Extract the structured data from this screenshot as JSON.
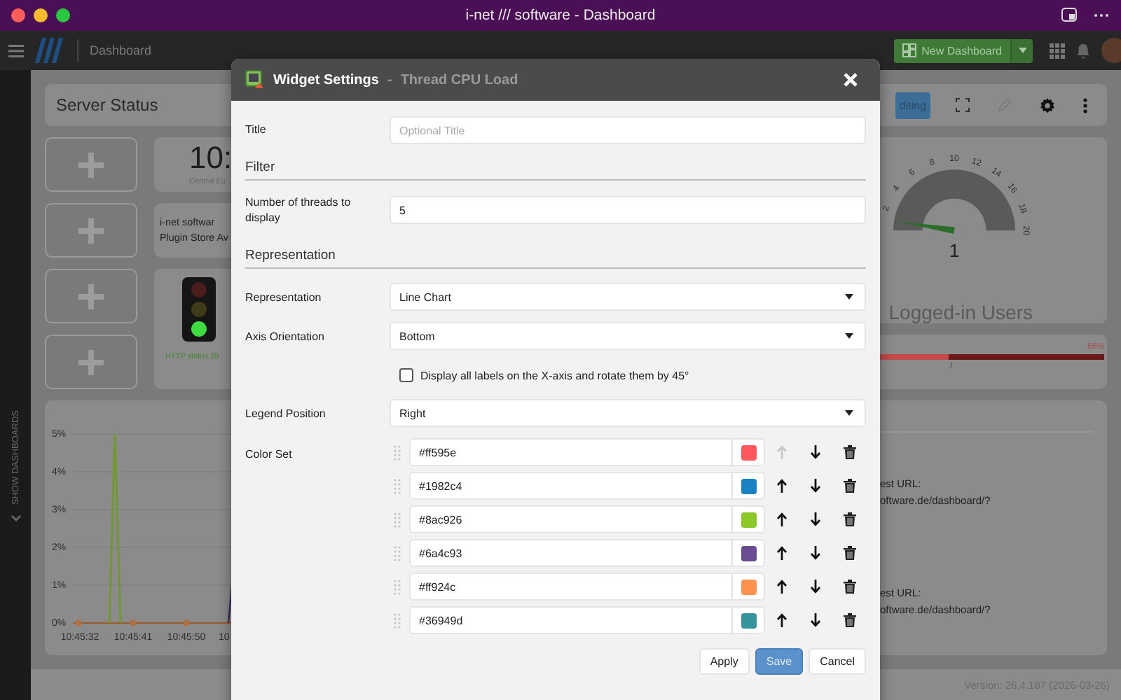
{
  "window": {
    "title": "i-net /// software - Dashboard"
  },
  "app_bar": {
    "page": "Dashboard",
    "new_button": "New Dashboard"
  },
  "sidebar": {
    "label": "SHOW DASHBOARDS"
  },
  "dashboard": {
    "title": "Server Status",
    "edit_button": "diting",
    "clock": {
      "time": "10:",
      "zone": "Central Eu"
    },
    "store": {
      "lines": [
        "i-net softwar",
        "Plugin Store Av"
      ]
    },
    "traffic_light": {
      "lamps": [
        {
          "on": false
        },
        {
          "on": false
        },
        {
          "on": true
        }
      ],
      "status": "HTTP status 20"
    },
    "chart": {
      "yticks": [
        "5%",
        "4%",
        "3%",
        "2%",
        "1%",
        "0%"
      ],
      "xticks": [
        "10:45:32",
        "10:45:41",
        "10:45:50",
        "10"
      ]
    },
    "gauge": {
      "ticks": [
        "2",
        "4",
        "6",
        "8",
        "10",
        "12",
        "14",
        "16",
        "18",
        "20"
      ],
      "value": "1",
      "title": "Logged-in Users"
    },
    "progress": {
      "reading": "66%",
      "level": 0.66,
      "caption": "/"
    },
    "url_card": {
      "lines": [
        "est URL:",
        "oftware.de/dashboard/?",
        "est URL:",
        "oftware.de/dashboard/?"
      ]
    },
    "version": "Version: 26.4.187 (2026-03-26)"
  },
  "dialog": {
    "title": "Widget Settings",
    "separator": "-",
    "subtitle": "Thread CPU Load",
    "rows": [
      {
        "kind": "input",
        "label": "Title",
        "placeholder": "Optional Title"
      },
      {
        "kind": "heading",
        "label": "Filter"
      },
      {
        "kind": "input",
        "label": "Number of threads to display",
        "value": "5"
      },
      {
        "kind": "heading",
        "label": "Representation"
      },
      {
        "kind": "select",
        "label": "Representation",
        "value": "Line Chart"
      },
      {
        "kind": "select",
        "label": "Axis Orientation",
        "value": "Bottom"
      },
      {
        "kind": "checkbox",
        "label": "Display all labels on the X-axis and rotate them by 45°",
        "checked": false
      },
      {
        "kind": "select",
        "label": "Legend Position",
        "value": "Right"
      },
      {
        "kind": "colorset",
        "label": "Color Set",
        "colors": [
          {
            "value": "#ff595e",
            "color": "#ff595e",
            "up_enabled": false
          },
          {
            "value": "#1982c4",
            "color": "#1982c4",
            "up_enabled": true
          },
          {
            "value": "#8ac926",
            "color": "#8ac926",
            "up_enabled": true
          },
          {
            "value": "#6a4c93",
            "color": "#6a4c93",
            "up_enabled": true
          },
          {
            "value": "#ff924c",
            "color": "#ff924c",
            "up_enabled": true
          },
          {
            "value": "#36949d",
            "color": "#36949d",
            "up_enabled": true
          }
        ]
      }
    ],
    "buttons": [
      {
        "label": "Apply",
        "primary": false
      },
      {
        "label": "Save",
        "primary": true
      },
      {
        "label": "Cancel",
        "primary": false
      }
    ]
  }
}
